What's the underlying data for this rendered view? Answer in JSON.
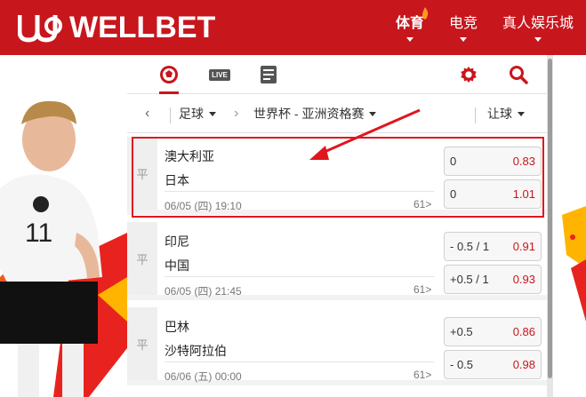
{
  "brand": {
    "logo_text": "WELLBET",
    "accent": "#c8161d"
  },
  "nav": [
    {
      "label": "体育",
      "active": true
    },
    {
      "label": "电竞",
      "active": false
    },
    {
      "label": "真人娱乐城",
      "active": false
    }
  ],
  "toolbar": {
    "live_label": "LIVE"
  },
  "filter": {
    "sport": "足球",
    "league": "世界杯 - 亚洲资格赛",
    "market": "让球"
  },
  "matches": [
    {
      "home": "澳大利亚",
      "away": "日本",
      "time": "06/05 (四) 19:10",
      "more": "61>",
      "odds": [
        {
          "line": "0",
          "price": "0.83"
        },
        {
          "line": "0",
          "price": "1.01"
        }
      ]
    },
    {
      "home": "印尼",
      "away": "中国",
      "time": "06/05 (四) 21:45",
      "more": "61>",
      "odds": [
        {
          "line": "- 0.5 / 1",
          "price": "0.91"
        },
        {
          "line": "+0.5 / 1",
          "price": "0.93"
        }
      ]
    },
    {
      "home": "巴林",
      "away": "沙特阿拉伯",
      "time": "06/06 (五) 00:00",
      "more": "61>",
      "odds": [
        {
          "line": "+0.5",
          "price": "0.86"
        },
        {
          "line": "- 0.5",
          "price": "0.98"
        }
      ]
    }
  ]
}
